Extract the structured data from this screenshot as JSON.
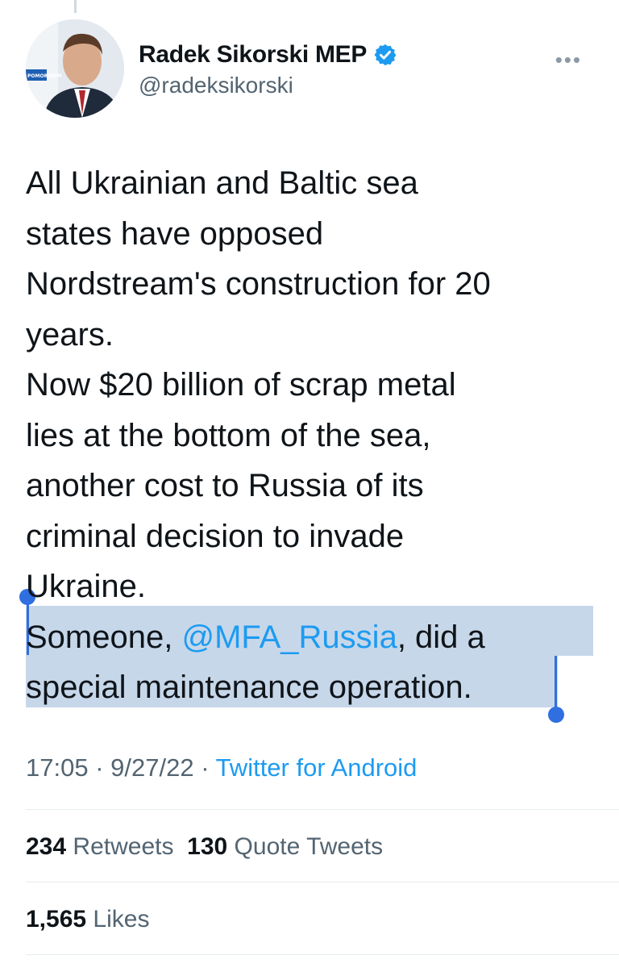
{
  "author": {
    "display_name": "Radek Sikorski MEP",
    "handle": "@radeksikorski",
    "avatar_badge_text": "POMORSKIM"
  },
  "more_label": "•••",
  "tweet": {
    "lines": [
      "All Ukrainian and Baltic sea",
      "states have opposed",
      "Nordstream's construction for 20",
      "years.",
      "Now $20 billion of scrap metal",
      "lies at the bottom of the sea,",
      "another cost to Russia of its",
      "criminal decision to invade",
      "Ukraine."
    ],
    "line10_before": "Someone, ",
    "mention": "@MFA_Russia",
    "line10_after": ", did a",
    "line11": "special maintenance operation."
  },
  "meta": {
    "time": "17:05",
    "sep1": " · ",
    "date": "9/27/22",
    "sep2": " · ",
    "source": "Twitter for Android"
  },
  "stats": {
    "retweets_count": "234",
    "retweets_label": "Retweets",
    "quotes_count": "130",
    "quotes_label": "Quote Tweets",
    "likes_count": "1,565",
    "likes_label": "Likes"
  },
  "colors": {
    "accent": "#1d9bf0",
    "selection": "#c7d7ea",
    "selection_handle": "#2f6fe0",
    "secondary_text": "#536471"
  }
}
